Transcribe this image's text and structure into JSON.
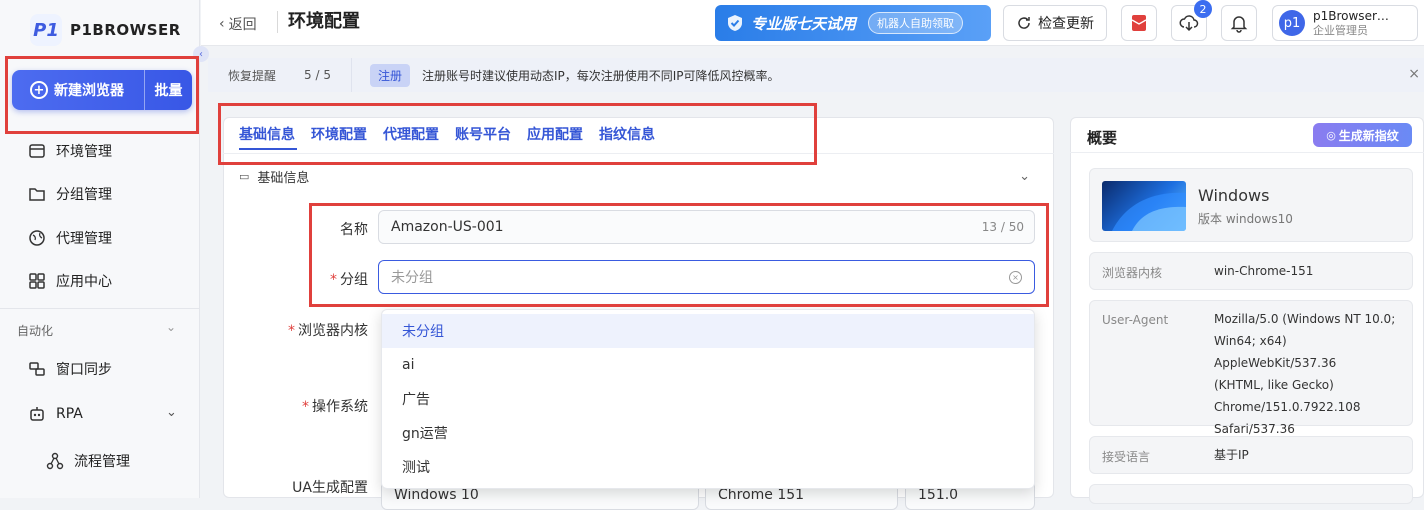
{
  "sidebar": {
    "logo_mark": "P1",
    "logo_text": "P1BROWSER",
    "new_browser": "新建浏览器",
    "batch": "批量",
    "items": [
      {
        "label": "环境管理"
      },
      {
        "label": "分组管理"
      },
      {
        "label": "代理管理"
      },
      {
        "label": "应用中心"
      }
    ],
    "automation_header": "自动化",
    "automation_items": [
      {
        "label": "窗口同步"
      },
      {
        "label": "RPA"
      },
      {
        "label": "流程管理"
      }
    ]
  },
  "header": {
    "back": "返回",
    "title": "环境配置",
    "promo_text": "专业版七天试用",
    "promo_pill": "机器人自助领取",
    "check_update": "检查更新",
    "download_badge": "2",
    "user_name": "p1Browser…",
    "user_role": "企业管理员",
    "avatar": "p1"
  },
  "notice": {
    "restore": "恢复提醒",
    "page": "5 / 5",
    "tag": "注册",
    "text": "注册账号时建议使用动态IP，每次注册使用不同IP可降低风控概率。",
    "close": "×"
  },
  "tabs": [
    {
      "label": "基础信息"
    },
    {
      "label": "环境配置"
    },
    {
      "label": "代理配置"
    },
    {
      "label": "账号平台"
    },
    {
      "label": "应用配置"
    },
    {
      "label": "指纹信息"
    }
  ],
  "section": {
    "title": "基础信息"
  },
  "form": {
    "name_label": "名称",
    "name_value": "Amazon-US-001",
    "name_count": "13 / 50",
    "group_label": "分组",
    "group_placeholder": "未分组",
    "kernel_label": "浏览器内核",
    "os_label": "操作系统",
    "ua_label": "UA生成配置",
    "ua_os_partial": "Windows 10",
    "ua_browser_partial": "Chrome 151",
    "ua_ver_partial": "151.0"
  },
  "dropdown": {
    "options": [
      "未分组",
      "ai",
      "广告",
      "gn运营",
      "测试"
    ],
    "selected": "未分组"
  },
  "summary": {
    "title": "概要",
    "generate_btn": "生成新指纹",
    "os_name": "Windows",
    "os_version": "版本 windows10",
    "kernel_key": "浏览器内核",
    "kernel_value": "win-Chrome-151",
    "ua_key": "User-Agent",
    "ua_lines": [
      "Mozilla/5.0 (Windows NT 10.0;",
      "Win64; x64) AppleWebKit/537.36",
      "(KHTML, like Gecko)",
      "Chrome/151.0.7922.108",
      "Safari/537.36"
    ],
    "lang_key": "接受语言",
    "lang_value": "基于IP"
  },
  "colors": {
    "accent": "#3556d6",
    "highlight_box": "#e0403c"
  }
}
